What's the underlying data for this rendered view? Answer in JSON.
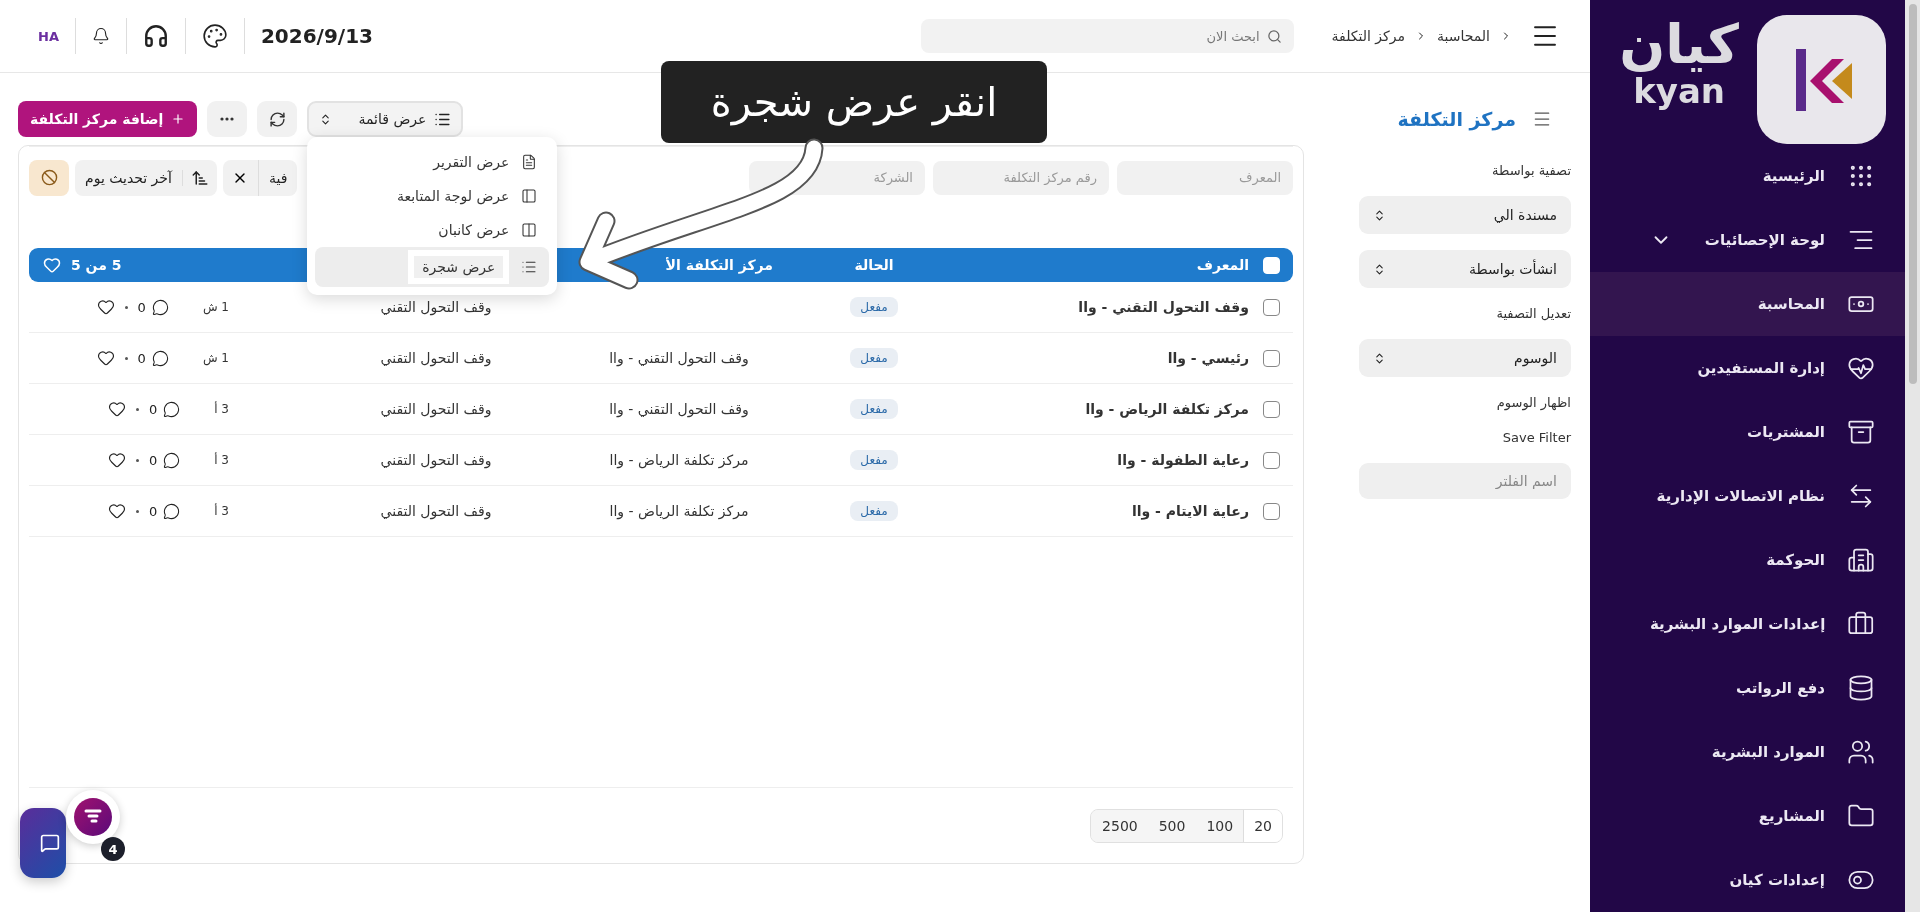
{
  "sidebar": {
    "logo": {
      "text": "كيان",
      "subtext": "kyan"
    },
    "items": [
      {
        "label": "الرئيسية",
        "selected": false,
        "expandable": false
      },
      {
        "label": "لوحة الإحصائيات",
        "selected": false,
        "expandable": true
      },
      {
        "label": "المحاسبة",
        "selected": true,
        "expandable": false
      },
      {
        "label": "إدارة المستفيدين",
        "selected": false,
        "expandable": false
      },
      {
        "label": "المشتريات",
        "selected": false,
        "expandable": false
      },
      {
        "label": "نظام الاتصالات الإدارية",
        "selected": false,
        "expandable": false
      },
      {
        "label": "الحوكمة",
        "selected": false,
        "expandable": false
      },
      {
        "label": "إعدادات الموارد البشرية",
        "selected": false,
        "expandable": false
      },
      {
        "label": "دفع الرواتب",
        "selected": false,
        "expandable": false
      },
      {
        "label": "الموارد البشرية",
        "selected": false,
        "expandable": false
      },
      {
        "label": "المشاريع",
        "selected": false,
        "expandable": false
      },
      {
        "label": "إعدادات كيان",
        "selected": false,
        "expandable": false
      }
    ]
  },
  "topbar": {
    "breadcrumb": [
      "المحاسبة",
      "مركز التكلفة"
    ],
    "search": {
      "placeholder": "ابحث الان"
    },
    "date": "2026/9/13",
    "user_initials": "HA"
  },
  "page": {
    "title": "مركز التكلفة"
  },
  "toolbar": {
    "view_selector": "عرض قائمة",
    "add_button": "إضافة مركز التكلفة"
  },
  "view_menu": [
    {
      "label": "عرض التقرير",
      "highlighted": false
    },
    {
      "label": "عرض لوجة المتابعة",
      "highlighted": false
    },
    {
      "label": "عرض كانبان",
      "highlighted": false
    },
    {
      "label": "عرض شجرة",
      "highlighted": true
    }
  ],
  "filter_panel": [
    {
      "kind": "label",
      "text": "تصفية بواسطة"
    },
    {
      "kind": "select",
      "text": "مسندة الي"
    },
    {
      "kind": "select",
      "text": "انشأت بواسطة"
    },
    {
      "kind": "label",
      "text": "تعديل التصفية"
    },
    {
      "kind": "select",
      "text": "الوسوم"
    },
    {
      "kind": "label",
      "text": "اظهار الوسوم"
    },
    {
      "kind": "label",
      "text": "Save Filter"
    },
    {
      "kind": "input",
      "placeholder": "اسم الفلتر"
    }
  ],
  "filters": {
    "search_fields": [
      {
        "placeholder": "المعرف"
      },
      {
        "placeholder": "رقم مركز التكلفة"
      },
      {
        "placeholder": "الشركة"
      }
    ],
    "active_filter": "فية",
    "sort": "آخر تحديث يوم"
  },
  "table": {
    "all_checked": false,
    "columns": [
      "المعرف",
      "الحالة",
      "مركز التكلفة الأ"
    ],
    "count": "5 من 5",
    "rows": [
      {
        "checked": false,
        "name": "وقف التحول التقني - واا",
        "status": "مفعل",
        "parent": "",
        "company": "وقف التحول التقني",
        "time": "1 ش",
        "comments": "0"
      },
      {
        "checked": false,
        "name": "رئيسي - واا",
        "status": "مفعل",
        "parent": "وقف التحول التقني - واا",
        "company": "وقف التحول التقني",
        "time": "1 ش",
        "comments": "0"
      },
      {
        "checked": false,
        "name": "مركز تكلفة الرياض - واا",
        "status": "مفعل",
        "parent": "وقف التحول التقني - واا",
        "company": "وقف التحول التقني",
        "time": "3 أ",
        "comments": "0"
      },
      {
        "checked": false,
        "name": "رعاية الطفولة - واا",
        "status": "مفعل",
        "parent": "مركز تكلفة الرياض - واا",
        "company": "وقف التحول التقني",
        "time": "3 أ",
        "comments": "0"
      },
      {
        "checked": false,
        "name": "رعاية الايتام - واا",
        "status": "مفعل",
        "parent": "مركز تكلفة الرياض - واا",
        "company": "وقف التحول التقني",
        "time": "3 أ",
        "comments": "0"
      }
    ]
  },
  "pagination": [
    {
      "label": "20",
      "selected": true
    },
    {
      "label": "100",
      "selected": false
    },
    {
      "label": "500",
      "selected": false
    },
    {
      "label": "2500",
      "selected": false
    }
  ],
  "chat": {
    "badge": "4"
  },
  "tutorial": {
    "tooltip": "انقر عرض شجرة"
  }
}
